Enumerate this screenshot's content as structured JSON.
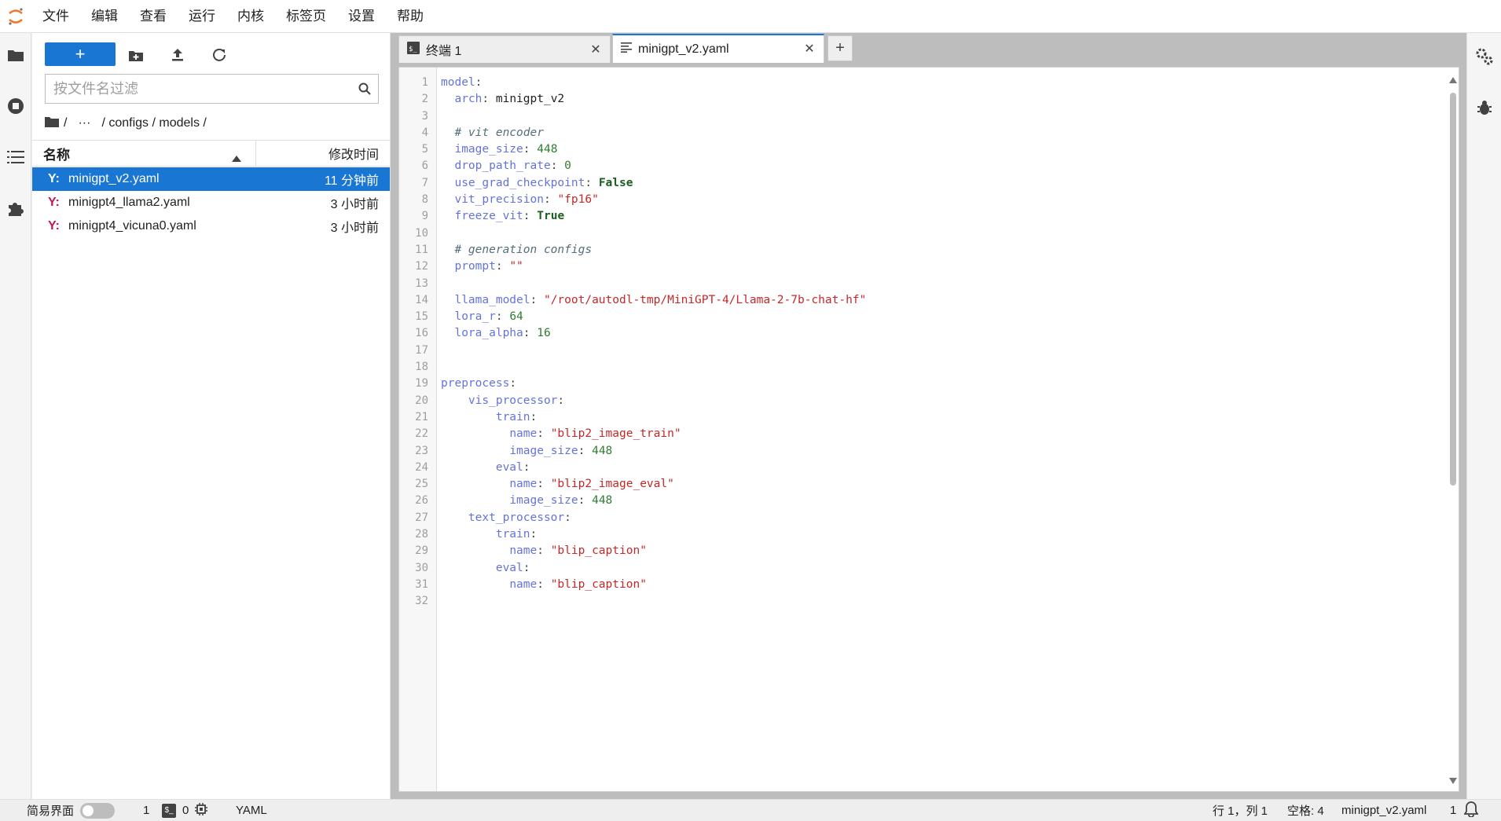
{
  "menubar": {
    "items": [
      "文件",
      "编辑",
      "查看",
      "运行",
      "内核",
      "标签页",
      "设置",
      "帮助"
    ]
  },
  "filebrowser": {
    "new_label": "+",
    "filter_placeholder": "按文件名过滤",
    "breadcrumb": [
      "/",
      "···",
      "/ configs / models /"
    ],
    "header": {
      "name": "名称",
      "modified": "修改时间"
    },
    "files": [
      {
        "icon": "Y:",
        "name": "minigpt_v2.yaml",
        "modified": "11 分钟前",
        "selected": true
      },
      {
        "icon": "Y:",
        "name": "minigpt4_llama2.yaml",
        "modified": "3 小时前",
        "selected": false
      },
      {
        "icon": "Y:",
        "name": "minigpt4_vicuna0.yaml",
        "modified": "3 小时前",
        "selected": false
      }
    ]
  },
  "tabs": [
    {
      "label": "终端 1",
      "icon": "terminal-icon",
      "active": false
    },
    {
      "label": "minigpt_v2.yaml",
      "icon": "text-file-icon",
      "active": true
    }
  ],
  "editor": {
    "line_count": 32
  },
  "statusbar": {
    "simple_mode": "简易界面",
    "kernels": "1",
    "terminals": "0",
    "language": "YAML",
    "cursor": "行 1，列 1",
    "indent": "空格: 4",
    "filename": "minigpt_v2.yaml",
    "notifications": "1"
  },
  "colors": {
    "accent": "#1976d2",
    "yaml_icon": "#c2185b"
  }
}
